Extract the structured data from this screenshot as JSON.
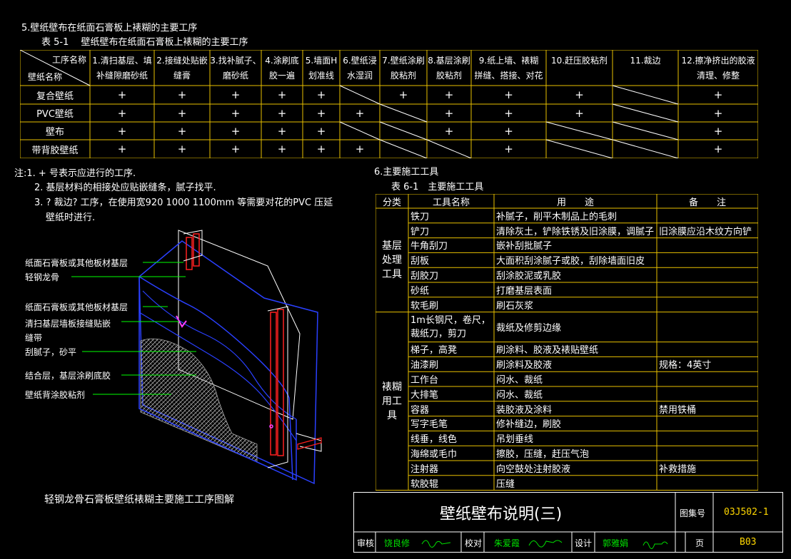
{
  "header": {
    "section_title": "5.壁纸壁布在纸面石膏板上裱糊的主要工序",
    "table_caption": "表 5-1　 壁纸壁布在纸面石膏板上裱糊的主要工序"
  },
  "process_table": {
    "corner_top": "工序名称",
    "corner_bottom": "壁纸名称",
    "columns": [
      [
        "1.清扫基层、填",
        "补缝隙磨砂纸"
      ],
      [
        "2.接缝处贴嵌",
        "缝膏"
      ],
      [
        "3.找补腻子、",
        "磨砂纸"
      ],
      [
        "4.涂刷底",
        "胶一遍"
      ],
      [
        "5.墙面H",
        "划准线"
      ],
      [
        "6.壁纸浸",
        "水湿润"
      ],
      [
        "7.壁纸涂刷",
        "胶粘剂"
      ],
      [
        "8.基层涂刷",
        "胶粘剂"
      ],
      [
        "9.纸上墙、裱糊",
        "拼缝、搭接、对花"
      ],
      [
        "10.赶压胶粘剂",
        ""
      ],
      [
        "11.裁边",
        ""
      ],
      [
        "12.擦净挤出的胶液",
        "清理、修整"
      ]
    ],
    "rows": [
      {
        "name": "复合壁纸",
        "cells": [
          "+",
          "+",
          "+",
          "+",
          "+",
          "/",
          "+",
          "+",
          "+",
          "+",
          "/",
          "+"
        ]
      },
      {
        "name": "PVC壁纸",
        "cells": [
          "+",
          "+",
          "+",
          "+",
          "+",
          "+",
          "/",
          "+",
          "+",
          "+",
          "/",
          "+"
        ]
      },
      {
        "name": "壁布",
        "cells": [
          "+",
          "+",
          "+",
          "+",
          "+",
          "/",
          "/",
          "+",
          "+",
          "/",
          "/",
          "+"
        ]
      },
      {
        "name": "带背胶壁纸",
        "cells": [
          "+",
          "+",
          "+",
          "+",
          "+",
          "+",
          "/",
          "/",
          "+",
          "/",
          "/",
          "+"
        ]
      }
    ]
  },
  "notes": {
    "lines": [
      "注:1. + 号表示应进行的工序.",
      "2. 基层材料的相接处应贴嵌缝条，腻子找平.",
      "3. ? 裁边? 工序，在使用宽920  1000  1100mm      等需要对花的PVC   压延",
      "壁纸时进行."
    ]
  },
  "diagram": {
    "labels": [
      "纸面石膏板或其他板材基层",
      "轻钢龙骨",
      "纸面石膏板或其他板材基层",
      "清扫基层墙板接缝贴嵌",
      "缝带",
      "刮腻子，砂平",
      "结合层，基层涂刷底胶",
      "壁纸背涂胶粘剂"
    ],
    "caption": "轻钢龙骨石膏板壁纸裱糊主要施工工序图解"
  },
  "tools": {
    "section_title": "6.主要施工工具",
    "table_caption": "表 6-1　主要施工工具",
    "headers": [
      "分类",
      "工具名称",
      "用　　途",
      "备　　注"
    ],
    "groups": [
      {
        "category": "基层处理工具",
        "items": [
          {
            "name": "铁刀",
            "use": "补腻子，削平木制品上的毛刺",
            "note": ""
          },
          {
            "name": "铲刀",
            "use": "清除灰土，铲除铁锈及旧涂膜，调腻子",
            "note": "旧涂膜应沿木纹方向铲"
          },
          {
            "name": "牛角刮刀",
            "use": "嵌补刮批腻子",
            "note": ""
          },
          {
            "name": "刮板",
            "use": "大面积刮涂腻子或胶，刮除墙面旧皮",
            "note": ""
          },
          {
            "name": "刮胶刀",
            "use": "刮涂胶泥或乳胶",
            "note": ""
          },
          {
            "name": "砂纸",
            "use": "打磨基层表面",
            "note": ""
          },
          {
            "name": "软毛刷",
            "use": "刷石灰浆",
            "note": ""
          }
        ]
      },
      {
        "category": "裱糊用工具",
        "items": [
          {
            "name": "1m长钢尺，卷尺，裁纸刀，剪刀",
            "use": "裁纸及修剪边缘",
            "note": ""
          },
          {
            "name": "梯子，高凳",
            "use": "刷涂料、胶液及裱贴壁纸",
            "note": ""
          },
          {
            "name": "油漆刷",
            "use": "刷涂料及胶液",
            "note": "规格：4英寸"
          },
          {
            "name": "工作台",
            "use": "闷水、裁纸",
            "note": ""
          },
          {
            "name": "大排笔",
            "use": "闷水、裁纸",
            "note": ""
          },
          {
            "name": "容器",
            "use": "装胶液及涂料",
            "note": "禁用铁桶"
          },
          {
            "name": "写字毛笔",
            "use": "修补缝边，刷胶",
            "note": ""
          },
          {
            "name": "线垂，线色",
            "use": "吊划垂线",
            "note": ""
          },
          {
            "name": "海绵或毛巾",
            "use": "擦胶，压缝，赶压气泡",
            "note": ""
          },
          {
            "name": "注射器",
            "use": "向空鼓处注射胶液",
            "note": "补救措施"
          },
          {
            "name": "软胶辊",
            "use": "压缝",
            "note": ""
          }
        ]
      }
    ]
  },
  "titleblock": {
    "title": "壁纸壁布说明(三)",
    "atlas_label": "图集号",
    "atlas_no": "03J502-1",
    "review_label": "审核",
    "reviewer": "饶良修",
    "check_label": "校对",
    "checker": "朱爱霞",
    "design_label": "设计",
    "designer": "郭雅娟",
    "page_label": "页",
    "page_no": "B03"
  }
}
